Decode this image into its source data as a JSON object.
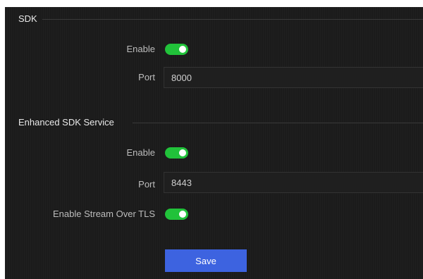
{
  "sdk": {
    "title": "SDK",
    "enable_label": "Enable",
    "enable_on": true,
    "port_label": "Port",
    "port_value": "8000"
  },
  "enhanced": {
    "title": "Enhanced SDK Service",
    "enable_label": "Enable",
    "enable_on": true,
    "port_label": "Port",
    "port_value": "8443",
    "tls_label": "Enable Stream Over TLS",
    "tls_on": true
  },
  "actions": {
    "save_label": "Save"
  },
  "colors": {
    "panel_bg": "#1b1b1b",
    "toggle_on": "#21c23a",
    "primary_button": "#3d63e0"
  }
}
